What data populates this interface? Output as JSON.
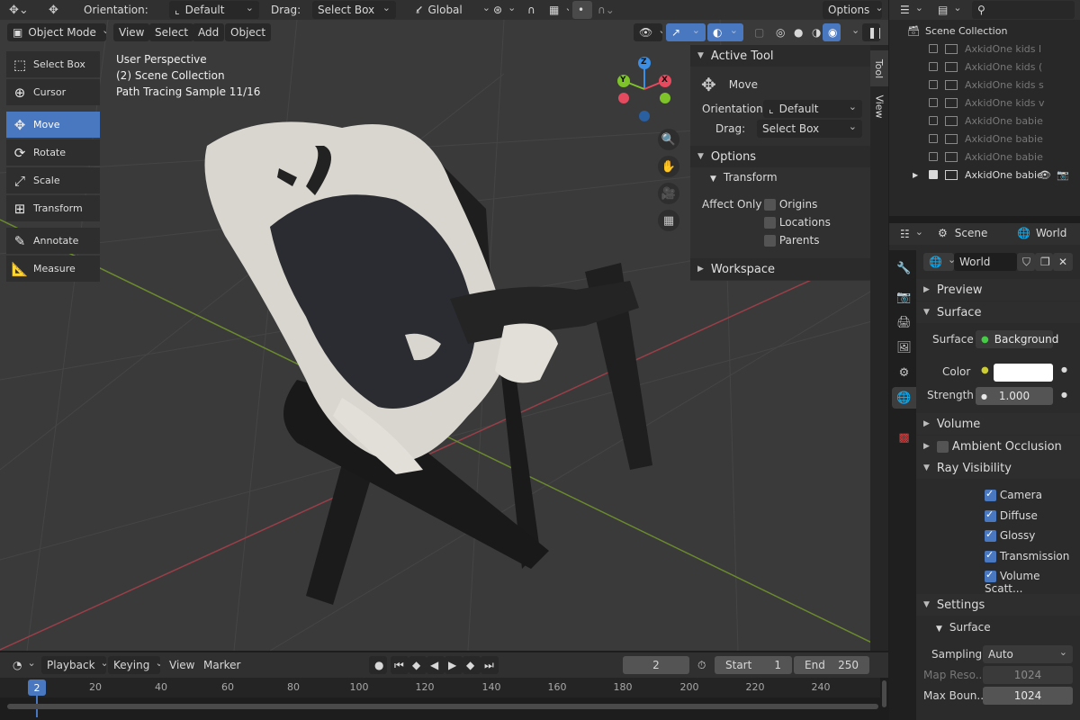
{
  "header": {
    "orientation_label": "Orientation:",
    "orientation_value": "Default",
    "drag_label": "Drag:",
    "drag_value": "Select Box",
    "transform_space": "Global",
    "options_label": "Options"
  },
  "viewport_header": {
    "mode": "Object Mode",
    "menus": [
      "View",
      "Select",
      "Add",
      "Object"
    ]
  },
  "viewport": {
    "overlay_lines": [
      "User Perspective",
      "(2) Scene Collection",
      "Path Tracing Sample 11/16"
    ],
    "gizmo_axes": [
      "Z",
      "Y",
      "X"
    ]
  },
  "toolbar": {
    "tools": [
      {
        "label": "Select Box",
        "icon": "select-box-icon"
      },
      {
        "label": "Cursor",
        "icon": "cursor-icon"
      },
      {
        "label": "Move",
        "icon": "move-icon",
        "active": true
      },
      {
        "label": "Rotate",
        "icon": "rotate-icon"
      },
      {
        "label": "Scale",
        "icon": "scale-icon"
      },
      {
        "label": "Transform",
        "icon": "transform-icon"
      },
      {
        "label": "Annotate",
        "icon": "annotate-icon"
      },
      {
        "label": "Measure",
        "icon": "measure-icon"
      }
    ]
  },
  "npanel": {
    "active_tool_title": "Active Tool",
    "tool_name": "Move",
    "orientation_label": "Orientation:",
    "orientation_value": "Default",
    "drag_label": "Drag:",
    "drag_value": "Select Box",
    "options_title": "Options",
    "transform_title": "Transform",
    "affect_only_label": "Affect Only",
    "affect_only": [
      "Origins",
      "Locations",
      "Parents"
    ],
    "workspace_title": "Workspace",
    "tabs": [
      "Tool",
      "View"
    ]
  },
  "outliner": {
    "search_placeholder": "",
    "root": "Scene Collection",
    "items": [
      {
        "label": "AxkidOne kids l",
        "checked": false
      },
      {
        "label": "AxkidOne kids (",
        "checked": false
      },
      {
        "label": "AxkidOne kids s",
        "checked": false
      },
      {
        "label": "AxkidOne kids v",
        "checked": false
      },
      {
        "label": "AxkidOne babie",
        "checked": false
      },
      {
        "label": "AxkidOne babie",
        "checked": false
      },
      {
        "label": "AxkidOne babie",
        "checked": false
      },
      {
        "label": "AxkidOne babie",
        "checked": true
      }
    ]
  },
  "properties": {
    "breadcrumb_scene": "Scene",
    "breadcrumb_world": "World",
    "datablock_name": "World",
    "sections": {
      "preview": "Preview",
      "surface": "Surface",
      "volume": "Volume",
      "ambient_occlusion": "Ambient Occlusion",
      "ray_visibility": "Ray Visibility",
      "settings": "Settings",
      "settings_surface": "Surface"
    },
    "surface_label": "Surface",
    "surface_value": "Background",
    "color_label": "Color",
    "color_value": "#ffffff",
    "strength_label": "Strength",
    "strength_value": "1.000",
    "ray_visibility": [
      "Camera",
      "Diffuse",
      "Glossy",
      "Transmission",
      "Volume Scatt..."
    ],
    "sampling_label": "Sampling",
    "sampling_value": "Auto",
    "map_res_label": "Map Reso...",
    "map_res_value": "1024",
    "max_bounces_label": "Max Boun...",
    "max_bounces_value": "1024"
  },
  "timeline": {
    "menus": [
      "Playback",
      "Keying",
      "View",
      "Marker"
    ],
    "current_frame": "2",
    "start_label": "Start",
    "start_value": "1",
    "end_label": "End",
    "end_value": "250",
    "ruler": [
      "20",
      "40",
      "60",
      "80",
      "100",
      "120",
      "140",
      "160",
      "180",
      "200",
      "220",
      "240"
    ],
    "playhead": "2"
  },
  "colors": {
    "accent": "#4a78c0",
    "axis_x": "#e54a5e",
    "axis_y": "#7fc32a",
    "axis_z": "#3b8ee3"
  }
}
